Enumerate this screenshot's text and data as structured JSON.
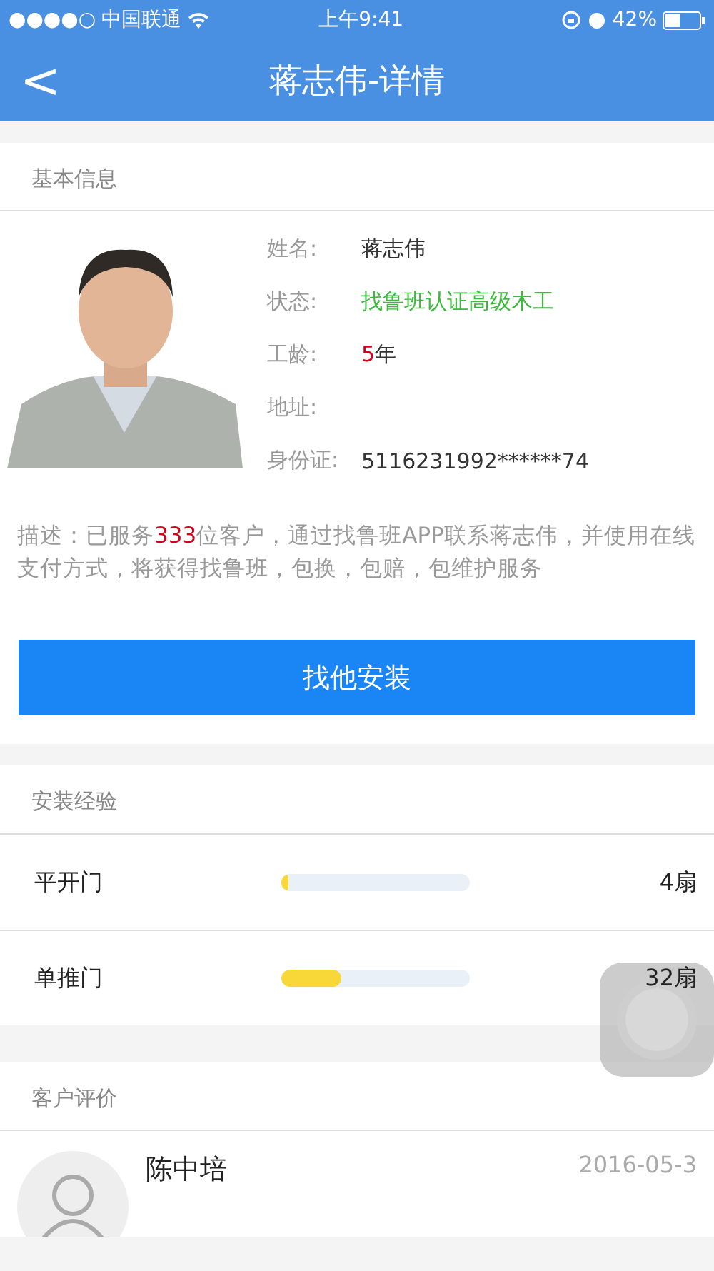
{
  "status_bar": {
    "signal": "●●●●○",
    "carrier": "中国联通",
    "time": "上午9:41",
    "battery": "42%"
  },
  "nav": {
    "back": "<",
    "title": "蒋志伟-详情"
  },
  "basic_info": {
    "header": "基本信息",
    "fields": [
      {
        "label": "姓名:",
        "parts": [
          {
            "text": "蒋志伟",
            "color": "#333333"
          }
        ]
      },
      {
        "label": "状态:",
        "parts": [
          {
            "text": "找鲁班认证高级木工",
            "color": "#3cba3c"
          }
        ]
      },
      {
        "label": "工龄:",
        "parts": [
          {
            "text": "5",
            "color": "#d0021b"
          },
          {
            "text": "年",
            "color": "#333333"
          }
        ]
      },
      {
        "label": "地址:"
      },
      {
        "label": "身份证:",
        "parts": [
          {
            "text": "5116231992******74",
            "color": "#333333"
          }
        ]
      }
    ],
    "description": [
      {
        "text": "描述：已服务",
        "color": "#999999"
      },
      {
        "text": "333",
        "color": "#d0021b"
      },
      {
        "text": "位客户，通过找鲁班APP联系蒋志伟，并使用在线支付方式，将获得找鲁班，包换，包赔，包维护服务",
        "color": "#999999"
      }
    ],
    "button": "找他安装"
  },
  "experience": {
    "header": "安装经验",
    "rows": [
      {
        "name": "平开门",
        "level": 0.04,
        "count": "4扇"
      },
      {
        "name": "单推门",
        "level": 0.32,
        "count": "32扇"
      }
    ]
  },
  "reviews": {
    "header": "客户评价",
    "items": [
      {
        "name": "陈中培",
        "date": "2016-05-3"
      }
    ]
  }
}
